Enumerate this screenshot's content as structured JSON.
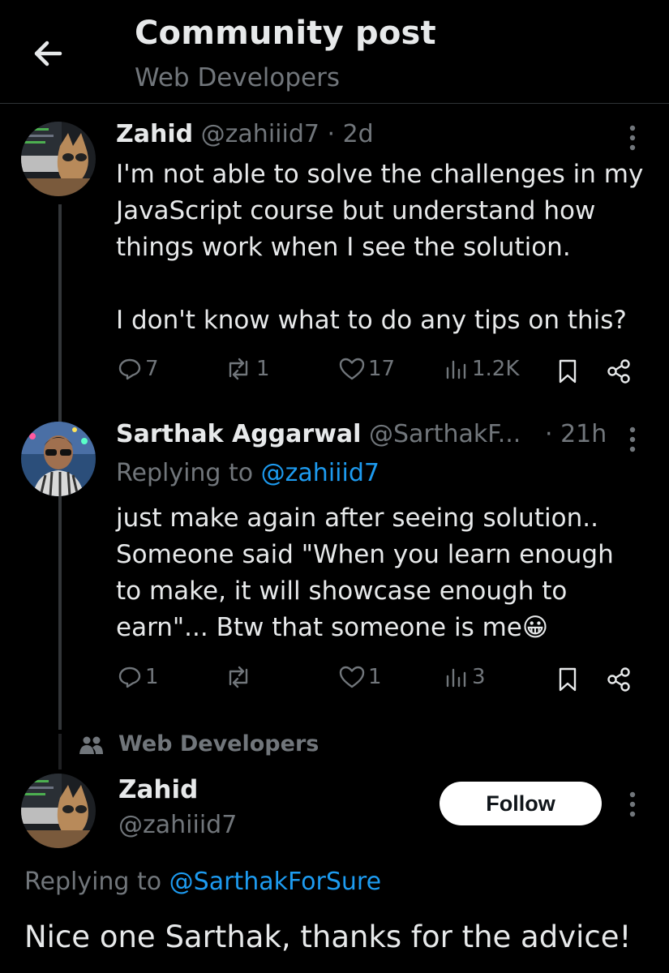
{
  "header": {
    "title": "Community post",
    "subtitle": "Web Developers"
  },
  "post1": {
    "name": "Zahid",
    "handle": "@zahiiid7",
    "time": "· 2d",
    "lines": [
      "I'm not able to solve the challenges in my",
      "JavaScript course but understand how",
      "things work when I see the solution.",
      "",
      "I don't know what to do any tips on this?"
    ],
    "replies": "7",
    "reposts": "1",
    "likes": "17",
    "views": "1.2K"
  },
  "post2": {
    "name": "Sarthak Aggarwal",
    "handle": "@SarthakF...",
    "time": "· 21h",
    "replying_prefix": "Replying to ",
    "replying_to": "@zahiiid7",
    "lines": [
      "just make again after seeing solution..",
      "Someone said \"When you learn enough",
      "to make, it will showcase enough to",
      "earn\"... Btw that someone is me"
    ],
    "emoji": "😀",
    "replies": "1",
    "reposts": "",
    "likes": "1",
    "views": "3"
  },
  "community_label": "Web Developers",
  "post3": {
    "name": "Zahid",
    "handle": "@zahiiid7",
    "follow_label": "Follow",
    "replying_prefix": "Replying to ",
    "replying_to": "@SarthakForSure",
    "text": "Nice one Sarthak, thanks for the advice!"
  },
  "colors": {
    "background": "#000000",
    "text": "#e7e9ea",
    "muted": "#71767b",
    "link": "#1d9bf0"
  }
}
